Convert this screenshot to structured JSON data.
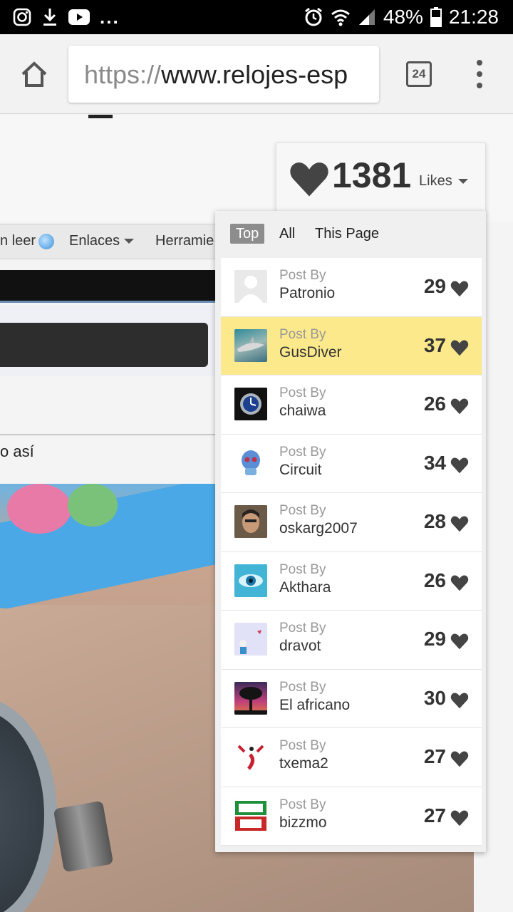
{
  "status_bar": {
    "battery": "48%",
    "time": "21:28",
    "more": "..."
  },
  "browser": {
    "url_scheme": "https://",
    "url_host": "www.relojes-esp",
    "tab_count": "24"
  },
  "page": {
    "nav_items": [
      {
        "label": "n leer"
      },
      {
        "label": "Enlaces"
      },
      {
        "label": "Herramie"
      }
    ],
    "post_snippet": "o así"
  },
  "likes_widget": {
    "total": "1381",
    "label": "Likes",
    "tabs": [
      {
        "label": "Top",
        "active": true
      },
      {
        "label": "All",
        "active": false
      },
      {
        "label": "This Page",
        "active": false
      }
    ],
    "rows": [
      {
        "prefix": "Post By",
        "user": "Patronio",
        "count": "29",
        "avatar": "default-avatar"
      },
      {
        "prefix": "Post By",
        "user": "GusDiver",
        "count": "37",
        "avatar": "shark-avatar",
        "highlight": true
      },
      {
        "prefix": "Post By",
        "user": "chaiwa",
        "count": "26",
        "avatar": "watch-avatar"
      },
      {
        "prefix": "Post By",
        "user": "Circuit",
        "count": "34",
        "avatar": "skull-avatar"
      },
      {
        "prefix": "Post By",
        "user": "oskarg2007",
        "count": "28",
        "avatar": "face-avatar"
      },
      {
        "prefix": "Post By",
        "user": "Akthara",
        "count": "26",
        "avatar": "eye-avatar"
      },
      {
        "prefix": "Post By",
        "user": "dravot",
        "count": "29",
        "avatar": "cartoon-avatar"
      },
      {
        "prefix": "Post By",
        "user": "El africano",
        "count": "30",
        "avatar": "sunset-tree-avatar"
      },
      {
        "prefix": "Post By",
        "user": "txema2",
        "count": "27",
        "avatar": "figure-avatar"
      },
      {
        "prefix": "Post By",
        "user": "bizzmo",
        "count": "27",
        "avatar": "bizzmo-logo-avatar"
      }
    ]
  },
  "colors": {
    "highlight_row": "#fbe98c",
    "active_tab": "#8d8d8d",
    "heart": "#444444"
  }
}
